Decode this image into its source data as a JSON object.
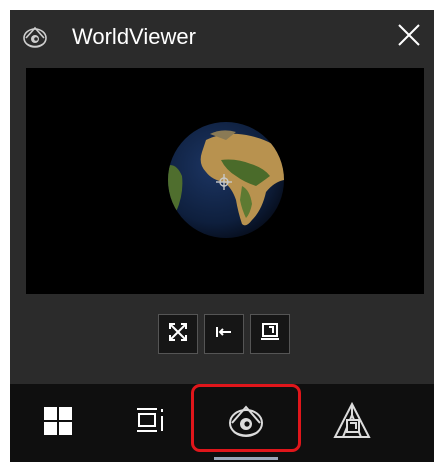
{
  "popup": {
    "title": "WorldViewer",
    "close_label": "×",
    "app_icon": "worldviewer-logo-icon"
  },
  "viewer": {
    "content": "earth-globe",
    "colors": {
      "ocean": "#0e1f3d",
      "land": "#b8924f",
      "vegetation": "#4a6b2a",
      "background": "#000000"
    }
  },
  "controls": [
    {
      "name": "fullscreen-button",
      "icon": "expand-arrows-icon"
    },
    {
      "name": "back-button",
      "icon": "arrow-left-icon"
    },
    {
      "name": "screen-button",
      "icon": "monitor-icon"
    }
  ],
  "taskbar": {
    "items": [
      {
        "name": "start-button",
        "icon": "windows-logo-icon"
      },
      {
        "name": "task-view-button",
        "icon": "task-view-icon"
      },
      {
        "name": "worldviewer-taskbar-button",
        "icon": "worldviewer-logo-icon",
        "active": true
      },
      {
        "name": "pinned-app-button",
        "icon": "pyramid-app-icon"
      }
    ],
    "highlight_color": "#e0161b"
  }
}
